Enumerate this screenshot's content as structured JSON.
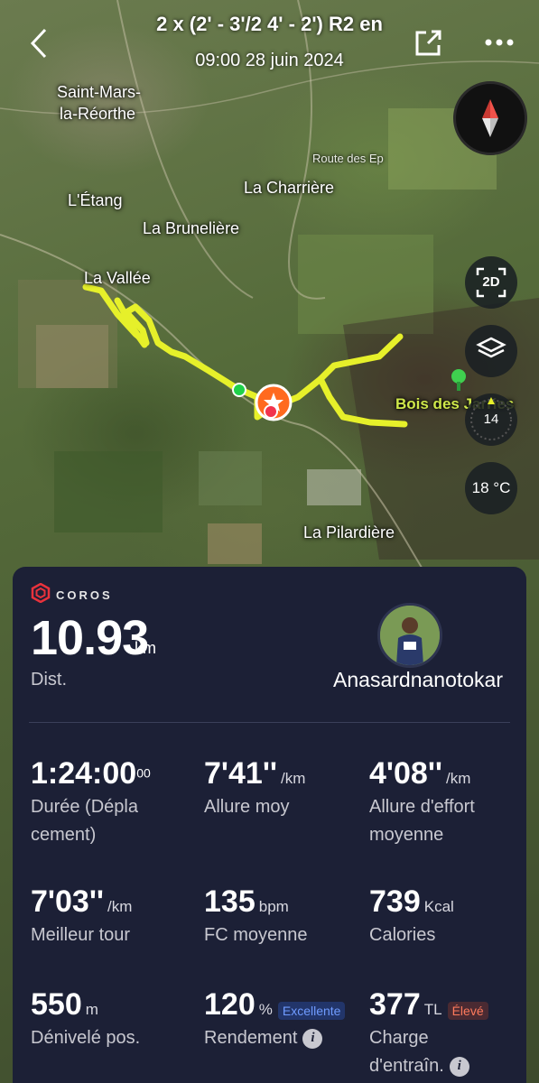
{
  "header": {
    "title": "2 x (2' - 3'/2 4' - 2') R2  en",
    "date": "09:00 28 juin 2024"
  },
  "map": {
    "places": [
      {
        "name": "Saint-Mars-",
        "key": "p1"
      },
      {
        "name": "la-Réorthe",
        "key": "p2"
      },
      {
        "name": "Route des Ep",
        "key": "p3"
      },
      {
        "name": "La Charrière",
        "key": "p4"
      },
      {
        "name": "L'Étang",
        "key": "p5"
      },
      {
        "name": "La Brunelière",
        "key": "p6"
      },
      {
        "name": "La Vallée",
        "key": "p7"
      },
      {
        "name": "Bois des Jarries",
        "key": "p8"
      },
      {
        "name": "La Pilardière",
        "key": "p9"
      }
    ],
    "mode_label": "2D",
    "wind_value": "14",
    "temperature": "18 °C"
  },
  "card": {
    "brand": "COROS",
    "distance": {
      "value": "10.93",
      "unit": "km",
      "label": "Dist."
    },
    "username": "Anasardnanotokar",
    "stats": [
      {
        "value": "1:24:00",
        "sup": "00",
        "unit": "",
        "label": "Durée (Dépla cement)"
      },
      {
        "value": "7'41''",
        "unit": "/km",
        "label": "Allure moy"
      },
      {
        "value": "4'08''",
        "unit": "/km",
        "label": "Allure d'effort moyenne"
      },
      {
        "value": "7'03''",
        "unit": "/km",
        "label": "Meilleur tour"
      },
      {
        "value": "135",
        "unit": "bpm",
        "label": "FC moyenne"
      },
      {
        "value": "739",
        "unit": "Kcal",
        "label": "Calories"
      },
      {
        "value": "550",
        "unit": "m",
        "label": "Dénivelé pos."
      },
      {
        "value": "120",
        "unit": "%",
        "badge": "Excellente",
        "label": "Rendement"
      },
      {
        "value": "377",
        "unit": "TL",
        "badge": "Élevé",
        "label": "Charge d'entraîn."
      }
    ]
  },
  "colors": {
    "track": "#e6f02a",
    "start": "#1fd14a",
    "end": "#f2334d",
    "marker": "#ff6a1f",
    "card_bg": "#1c2036",
    "badge_good": "#3b6fe0",
    "badge_high": "#e0553b"
  },
  "icons": [
    "back-arrow-icon",
    "share-icon",
    "more-icon",
    "compass-icon",
    "layers-icon",
    "tree-icon",
    "info-icon",
    "coros-logo-icon"
  ]
}
